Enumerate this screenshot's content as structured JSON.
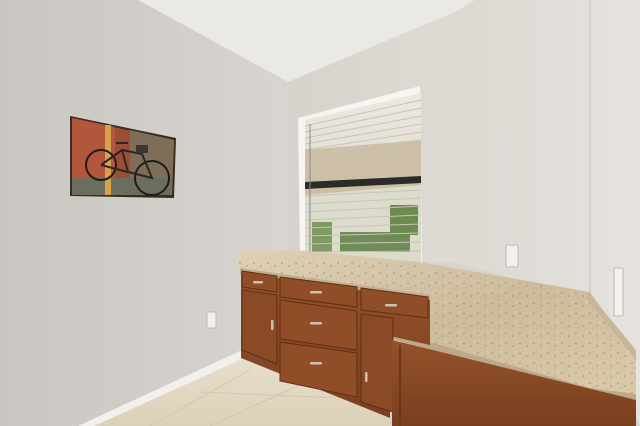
{
  "scene": {
    "description_colors": {
      "wall_left": "#d3d0cb",
      "wall_back": "#ddd9d3",
      "wall_right": "#e2dfd9",
      "ceiling": "#ebe9e4",
      "floor": "#e4d9c5",
      "cabinet": "#8a4a25",
      "cabinet_dark": "#6e3818",
      "granite": "#d8c9ad",
      "baseboard": "#f2f0ec",
      "blind": "#e9e6df"
    }
  }
}
